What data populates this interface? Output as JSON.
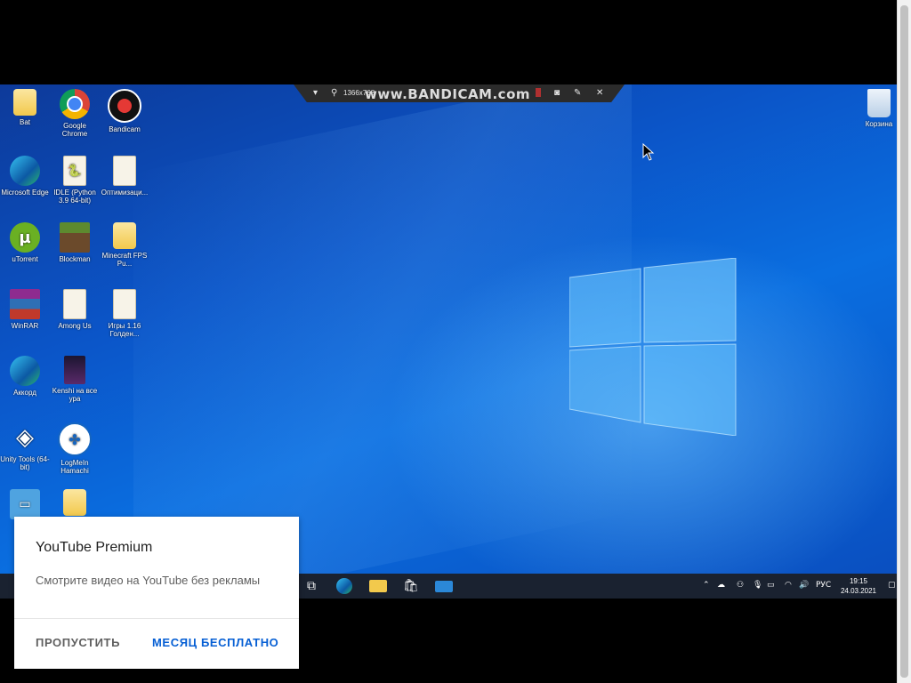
{
  "bandicam": {
    "resolution": "1366x768",
    "logo": "www.BANDICAM.com",
    "chevron_icon": "chevron-down-icon",
    "pin_icon": "pin-icon",
    "camera_icon": "camera-icon",
    "pencil_icon": "pencil-icon",
    "close_icon": "close-icon"
  },
  "desktop": {
    "icons": [
      {
        "label": "Bat",
        "icon": "folder-icon"
      },
      {
        "label": "Google Chrome",
        "icon": "chrome-icon"
      },
      {
        "label": "Bandicam",
        "icon": "bandicam-icon"
      },
      {
        "label": "Microsoft Edge",
        "icon": "edge-icon"
      },
      {
        "label": "IDLE (Python 3.9 64-bit)",
        "icon": "python-icon"
      },
      {
        "label": "Оптимизаци...",
        "icon": "folder-icon"
      },
      {
        "label": "uTorrent",
        "icon": "utorrent-icon"
      },
      {
        "label": "Blockman",
        "icon": "minecraft-icon"
      },
      {
        "label": "Minecraft FPS Pu...",
        "icon": "folder-icon"
      },
      {
        "label": "WinRAR",
        "icon": "winrar-icon"
      },
      {
        "label": "Among Us",
        "icon": "document-icon"
      },
      {
        "label": "Игры 1.16 Голден...",
        "icon": "document-icon"
      },
      {
        "label": "Аккорд",
        "icon": "edge-icon"
      },
      {
        "label": "Kenshi на все ура",
        "icon": "game-icon"
      },
      {
        "label": "Unity Tools (64-bit)",
        "icon": "unity-icon"
      },
      {
        "label": "LogMeIn Hamachi",
        "icon": "hamachi-icon"
      },
      {
        "label": "",
        "icon": "remote-desktop-icon"
      },
      {
        "label": "",
        "icon": "folder-icon"
      }
    ],
    "recycle_bin": {
      "label": "Корзина",
      "icon": "recycle-bin-icon"
    }
  },
  "taskbar": {
    "pinned": [
      "task-view-icon",
      "edge-icon",
      "file-explorer-icon",
      "store-icon",
      "mail-icon"
    ],
    "tray_lang": "РУС",
    "time": "19:15",
    "date": "24.03.2021"
  },
  "dialog": {
    "title": "YouTube Premium",
    "message": "Смотрите видео на YouTube без рекламы",
    "skip_label": "ПРОПУСТИТЬ",
    "trial_label": "МЕСЯЦ БЕСПЛАТНО"
  },
  "colors": {
    "accent": "#065fd4",
    "desktop_blue": "#0a6ee0",
    "taskbar": "#1a2230"
  }
}
